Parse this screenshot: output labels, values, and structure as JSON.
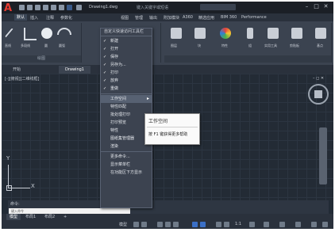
{
  "titlebar": {
    "logo": "A",
    "doc_title": "Drawing1.dwg",
    "title_suffix": "键入关键字或短语",
    "minimize": "–",
    "restore": "□",
    "close": "✕"
  },
  "ribbon": {
    "tabs": [
      "默认",
      "插入",
      "注释",
      "参数化",
      "视图",
      "管理",
      "输出",
      "附加模块",
      "A360",
      "精选应用",
      "BIM 360",
      "Performance"
    ],
    "active_tab": "默认",
    "tools": [
      {
        "label": "直线",
        "color": "#d8dde4"
      },
      {
        "label": "多段线",
        "color": "#d8dde4"
      },
      {
        "label": "圆",
        "color": "#e8ecf0"
      },
      {
        "label": "圆弧",
        "color": "#d8dde4"
      }
    ],
    "right_tools": [
      {
        "label": "图层",
        "color": "#c9ced6"
      },
      {
        "label": "块",
        "color": "#c9ced6"
      },
      {
        "label": "特性",
        "color": "#e88a3a"
      },
      {
        "label": "组",
        "color": "#c9ced6"
      },
      {
        "label": "实用工具",
        "color": "#c9ced6"
      },
      {
        "label": "剪贴板",
        "color": "#c9ced6"
      },
      {
        "label": "基点",
        "color": "#c9ced6"
      }
    ],
    "panel_draw": "绘图"
  },
  "file_tabs": [
    "开始",
    "Drawing1"
  ],
  "canvas": {
    "view_label": "[-][俯视][二维线框]",
    "ucs_x": "X",
    "ucs_y": "Y",
    "win_ctrl": "– ◻ ✕"
  },
  "dropdown_menu": {
    "header": "自定义快速访问工具栏",
    "items": [
      {
        "label": "新建",
        "checked": true
      },
      {
        "label": "打开",
        "checked": true
      },
      {
        "label": "保存",
        "checked": true
      },
      {
        "label": "另存为...",
        "checked": true
      },
      {
        "label": "打印",
        "checked": true
      },
      {
        "label": "放弃",
        "checked": true
      },
      {
        "label": "重做",
        "checked": true
      },
      {
        "label": "工作空间",
        "checked": false,
        "highlight": true,
        "arrow": "▸"
      },
      {
        "label": "特性匹配",
        "checked": false
      },
      {
        "label": "批处理打印",
        "checked": false
      },
      {
        "label": "打印预览",
        "checked": false
      },
      {
        "label": "特性",
        "checked": false
      },
      {
        "label": "图纸集管理器",
        "checked": false
      },
      {
        "label": "渲染",
        "checked": false
      },
      {
        "label": "更多命令...",
        "checked": false
      },
      {
        "label": "显示菜单栏",
        "checked": false
      },
      {
        "label": "在功能区下方显示",
        "checked": false
      }
    ]
  },
  "tooltip": {
    "title": "工作空间",
    "help": "按 F1 键获得更多帮助"
  },
  "command_line": {
    "history": "命令:",
    "placeholder": "键入命令"
  },
  "layout_tabs": [
    "模型",
    "布局1",
    "布局2",
    "+"
  ],
  "status_bar": {
    "model_label": "模型",
    "scale": "1:1"
  }
}
